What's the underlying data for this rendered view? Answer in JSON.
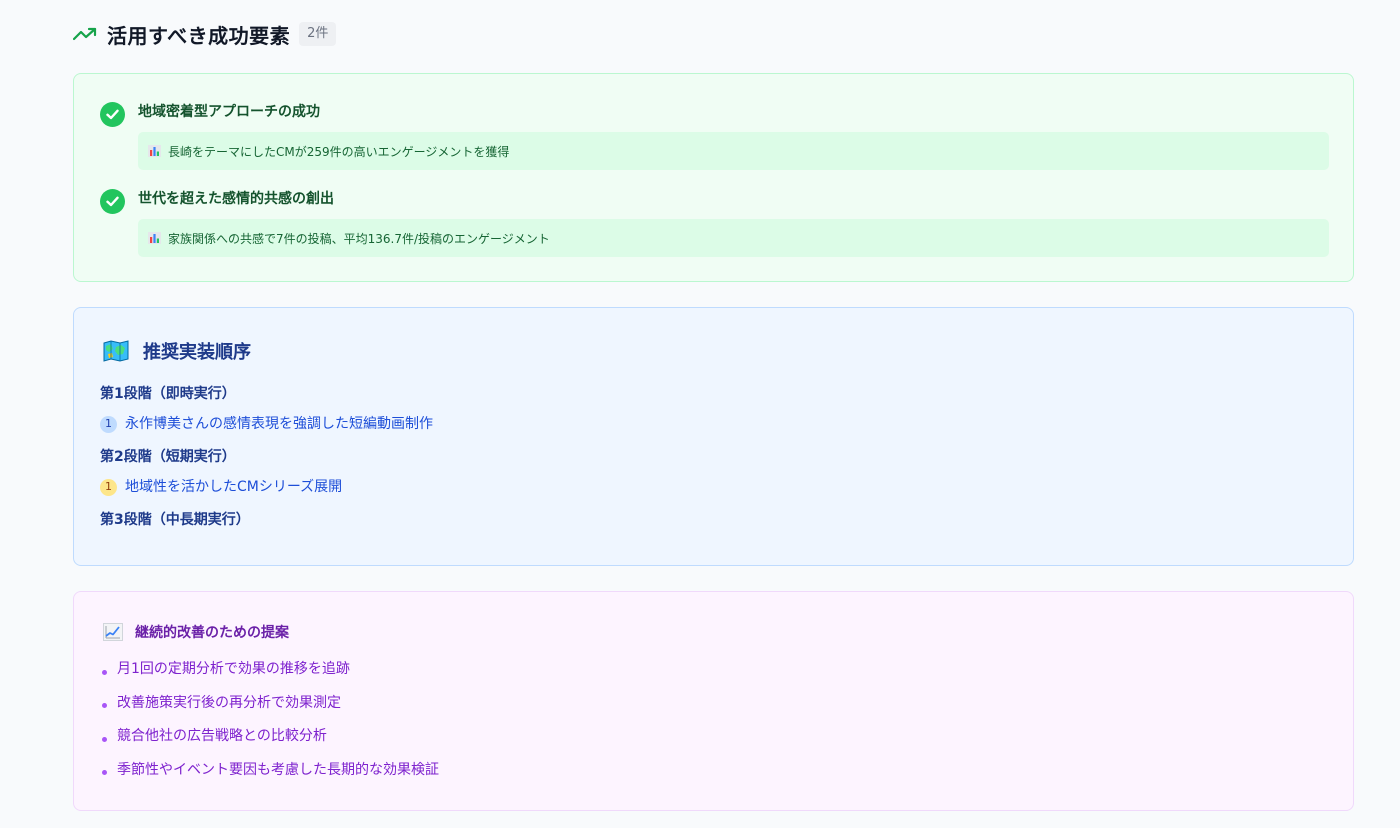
{
  "header": {
    "icon": "trending-up-icon",
    "title": "活用すべき成功要素",
    "count": "2件"
  },
  "success_factors": [
    {
      "title": "地域密着型アプローチの成功",
      "evidence": "長崎をテーマにしたCMが259件の高いエンゲージメントを獲得"
    },
    {
      "title": "世代を超えた感情的共感の創出",
      "evidence": "家族関係への共感で7件の投稿、平均136.7件/投稿のエンゲージメント"
    }
  ],
  "roadmap": {
    "icon": "map-icon",
    "title": "推奨実装順序",
    "phases": [
      {
        "title": "第1段階（即時実行）",
        "items": [
          {
            "num": "1",
            "text": "永作博美さんの感情表現を強調した短編動画制作"
          }
        ]
      },
      {
        "title": "第2段階（短期実行）",
        "items": [
          {
            "num": "1",
            "text": "地域性を活かしたCMシリーズ展開"
          }
        ]
      },
      {
        "title": "第3段階（中長期実行）",
        "items": []
      }
    ]
  },
  "improvement": {
    "icon": "line-chart-icon",
    "title": "継続的改善のための提案",
    "items": [
      "月1回の定期分析で効果の推移を追跡",
      "改善施策実行後の再分析で効果測定",
      "競合他社の広告戦略との比較分析",
      "季節性やイベント要因も考慮した長期的な効果検証"
    ]
  },
  "colors": {
    "success_accent": "#22c55e",
    "roadmap_accent": "#1e3a8a",
    "improve_accent": "#7e22ce"
  }
}
